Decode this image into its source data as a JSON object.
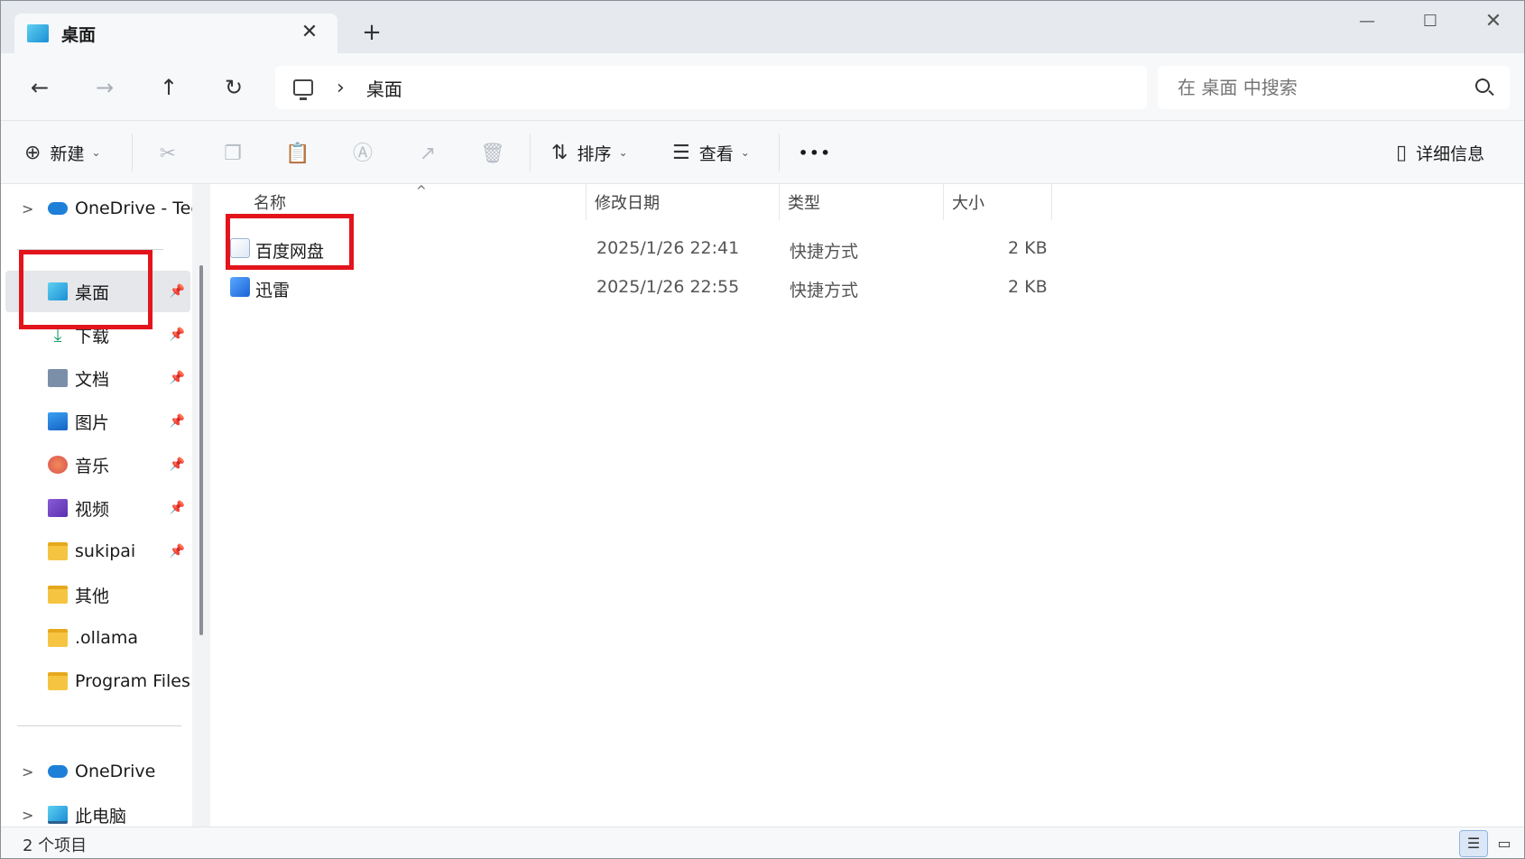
{
  "tab": {
    "title": "桌面",
    "close_glyph": "✕",
    "new_tab_glyph": "+"
  },
  "window_controls": {
    "minimize": "—",
    "maximize": "☐",
    "close": "✕"
  },
  "nav": {
    "back": "←",
    "forward": "→",
    "up": "↑",
    "refresh": "↻",
    "breadcrumb_chevron": "›",
    "breadcrumb": "桌面",
    "search_placeholder": "在 桌面 中搜索"
  },
  "commands": {
    "new": "新建",
    "new_icon": "⊕",
    "sort": "排序",
    "sort_icon": "⇅",
    "view": "查看",
    "view_icon": "☰",
    "more": "•••",
    "details": "详细信息",
    "details_icon": "▯",
    "cut_icon": "✂",
    "copy_icon": "❐",
    "paste_icon": "📋",
    "rename_icon": "Ⓐ",
    "share_icon": "↗",
    "delete_icon": "🗑"
  },
  "sidebar": {
    "top": [
      {
        "label": "OneDrive - Tec",
        "expand": ">"
      }
    ],
    "quick_access": [
      {
        "label": "桌面",
        "pin": "📌"
      },
      {
        "label": "下载",
        "pin": "📌"
      },
      {
        "label": "文档",
        "pin": "📌"
      },
      {
        "label": "图片",
        "pin": "📌"
      },
      {
        "label": "音乐",
        "pin": "📌"
      },
      {
        "label": "视频",
        "pin": "📌"
      },
      {
        "label": "sukipai",
        "pin": "📌"
      },
      {
        "label": "其他"
      },
      {
        "label": ".ollama"
      },
      {
        "label": "Program Files"
      }
    ],
    "bottom": [
      {
        "label": "OneDrive",
        "expand": ">"
      },
      {
        "label": "此电脑",
        "expand": ">"
      }
    ]
  },
  "columns": {
    "name": "名称",
    "modified": "修改日期",
    "type": "类型",
    "size": "大小",
    "sort_indicator": "^"
  },
  "files": [
    {
      "name": "百度网盘",
      "modified": "2025/1/26 22:41",
      "type": "快捷方式",
      "size": "2 KB"
    },
    {
      "name": "迅雷",
      "modified": "2025/1/26 22:55",
      "type": "快捷方式",
      "size": "2 KB"
    }
  ],
  "status": {
    "item_count": "2 个项目",
    "details_view_glyph": "☰",
    "tiles_view_glyph": "▭"
  },
  "colors": {
    "highlight": "#e3141b",
    "selection": "#e5e7ea",
    "accent": "#1a8fd6"
  }
}
